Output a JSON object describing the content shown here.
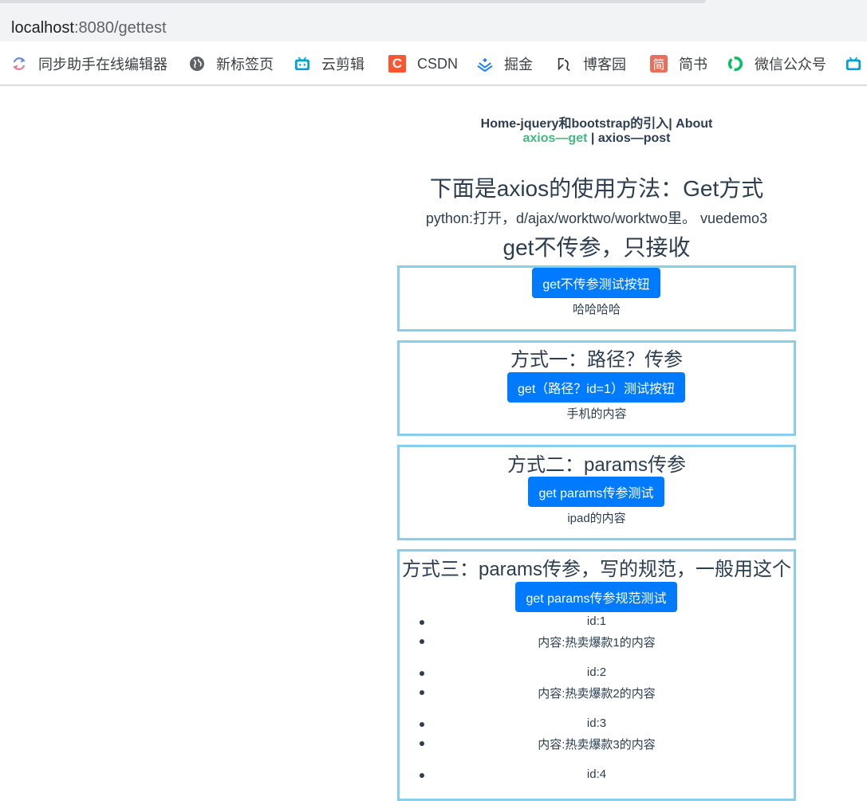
{
  "browser": {
    "url_host": "localhost",
    "url_rest": ":8080/gettest",
    "bookmarks": [
      {
        "label": "同步助手在线编辑器",
        "icon": "sync-icon"
      },
      {
        "label": "新标签页",
        "icon": "globe-icon"
      },
      {
        "label": "云剪辑",
        "icon": "bilibili-icon"
      },
      {
        "label": "CSDN",
        "icon": "csdn-icon"
      },
      {
        "label": "掘金",
        "icon": "juejin-icon"
      },
      {
        "label": "博客园",
        "icon": "cnblogs-icon"
      },
      {
        "label": "简书",
        "icon": "jianshu-icon"
      },
      {
        "label": "微信公众号",
        "icon": "wechat-icon"
      }
    ],
    "colors": {
      "csdn": "#fc5531",
      "juejin": "#1e80ff",
      "jianshu": "#ea6f5a",
      "wechat": "#07c160",
      "bilibili": "#00a1d6"
    }
  },
  "nav": {
    "home": "Home-jquery和bootstrap的引入",
    "sep1": "|",
    "about": "About",
    "get": "axios—get",
    "sep2": "|",
    "post": "axios—post"
  },
  "page": {
    "title": "下面是axios的使用方法：Get方式",
    "note": "python:打开，d/ajax/worktwo/worktwo里。 vuedemo3",
    "section_title": "get不传参，只接收"
  },
  "box1": {
    "button": "get不传参测试按钮",
    "result": "哈哈哈哈"
  },
  "box2": {
    "title": "方式一：路径？传参",
    "button": "get（路径？id=1）测试按钮",
    "result": "手机的内容"
  },
  "box3": {
    "title": "方式二：params传参",
    "button": "get params传参测试",
    "result": "ipad的内容"
  },
  "box4": {
    "title": "方式三：params传参，写的规范，一般用这个",
    "button": "get params传参规范测试",
    "items": [
      {
        "id": "id:1",
        "content": "内容:热卖爆款1的内容"
      },
      {
        "id": "id:2",
        "content": "内容:热卖爆款2的内容"
      },
      {
        "id": "id:3",
        "content": "内容:热卖爆款3的内容"
      },
      {
        "id": "id:4",
        "content": ""
      }
    ]
  },
  "colors": {
    "accent": "#007bff",
    "border": "#87ceeb",
    "active_link": "#42b983",
    "text": "#2c3e50"
  }
}
